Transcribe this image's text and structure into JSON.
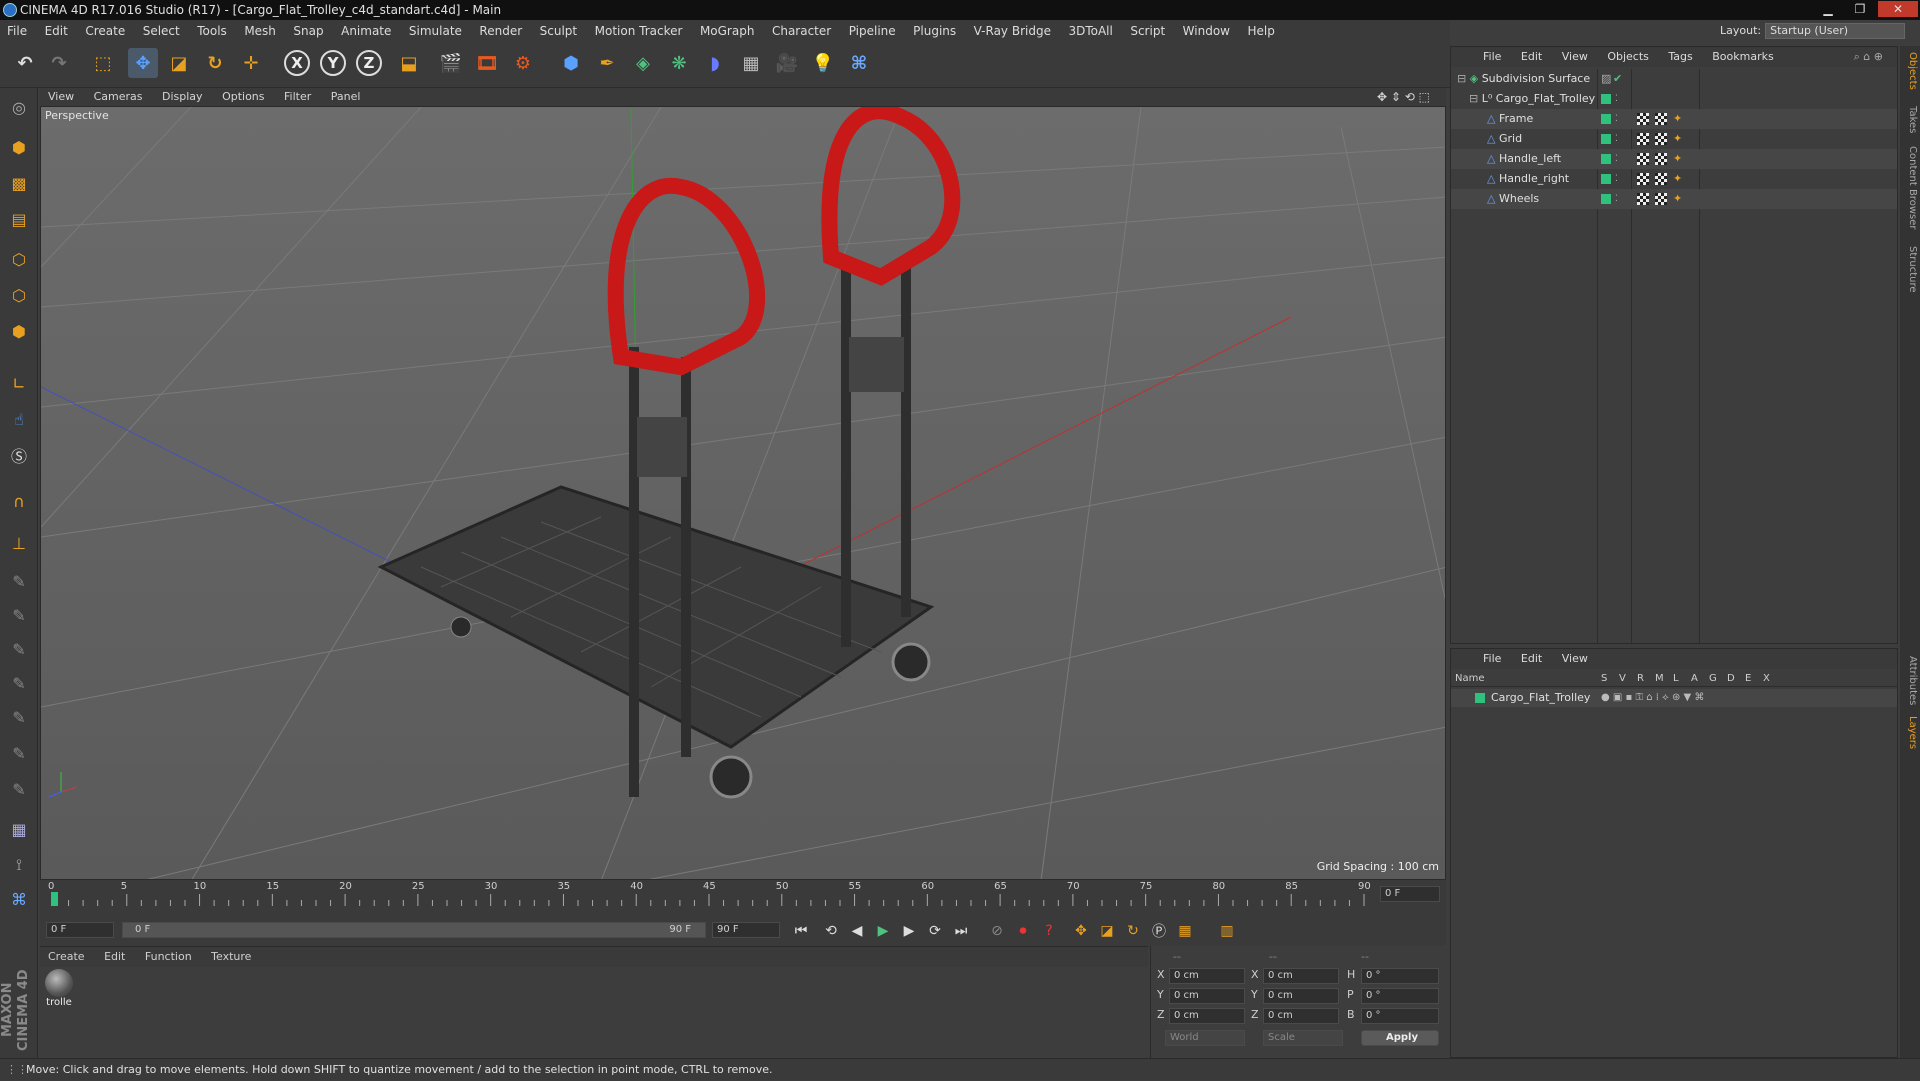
{
  "window": {
    "title": "CINEMA 4D R17.016 Studio (R17) - [Cargo_Flat_Trolley_c4d_standart.c4d] - Main",
    "min": "▁",
    "max": "❐",
    "close": "✕"
  },
  "menubar": [
    "File",
    "Edit",
    "Create",
    "Select",
    "Tools",
    "Mesh",
    "Snap",
    "Animate",
    "Simulate",
    "Render",
    "Sculpt",
    "Motion Tracker",
    "MoGraph",
    "Character",
    "Pipeline",
    "Plugins",
    "V-Ray Bridge",
    "3DToAll",
    "Script",
    "Window",
    "Help"
  ],
  "layout": {
    "label": "Layout:",
    "value": "Startup (User)"
  },
  "toolbar": {
    "x": "X",
    "y": "Y",
    "z": "Z"
  },
  "viewport": {
    "menu": [
      "View",
      "Cameras",
      "Display",
      "Options",
      "Filter",
      "Panel"
    ],
    "label": "Perspective",
    "grid_spacing": "Grid Spacing : 100 cm"
  },
  "timeline": {
    "ticks": [
      "0",
      "5",
      "10",
      "15",
      "20",
      "25",
      "30",
      "35",
      "40",
      "45",
      "50",
      "55",
      "60",
      "65",
      "70",
      "75",
      "80",
      "85",
      "90"
    ],
    "current_frame": "0 F",
    "start": "0 F",
    "range_start": "0 F",
    "range_end": "90 F",
    "end": "90 F"
  },
  "materials": {
    "menu": [
      "Create",
      "Edit",
      "Function",
      "Texture"
    ],
    "items": [
      {
        "name": "trolle"
      }
    ]
  },
  "coordinates": {
    "headers": [
      "--",
      "--",
      "--"
    ],
    "rows": [
      {
        "a": "X",
        "av": "0 cm",
        "b": "X",
        "bv": "0 cm",
        "c": "H",
        "cv": "0 °"
      },
      {
        "a": "Y",
        "av": "0 cm",
        "b": "Y",
        "bv": "0 cm",
        "c": "P",
        "cv": "0 °"
      },
      {
        "a": "Z",
        "av": "0 cm",
        "b": "Z",
        "bv": "0 cm",
        "c": "B",
        "cv": "0 °"
      }
    ],
    "space": "World",
    "mode": "Scale",
    "apply": "Apply"
  },
  "objects": {
    "menu": [
      "File",
      "Edit",
      "View",
      "Objects",
      "Tags",
      "Bookmarks"
    ],
    "tree": [
      {
        "name": "Subdivision Surface",
        "level": 0
      },
      {
        "name": "Cargo_Flat_Trolley",
        "level": 1
      },
      {
        "name": "Frame",
        "level": 2
      },
      {
        "name": "Grid",
        "level": 2
      },
      {
        "name": "Handle_left",
        "level": 2
      },
      {
        "name": "Handle_right",
        "level": 2
      },
      {
        "name": "Wheels",
        "level": 2
      }
    ]
  },
  "layers": {
    "menu": [
      "File",
      "Edit",
      "View"
    ],
    "name_header": "Name",
    "col_headers": [
      "S",
      "V",
      "R",
      "M",
      "L",
      "A",
      "G",
      "D",
      "E",
      "X"
    ],
    "rows": [
      {
        "name": "Cargo_Flat_Trolley"
      }
    ]
  },
  "right_tabs": [
    "Objects",
    "Takes",
    "Content Browser",
    "Structure",
    "Attributes",
    "Layers"
  ],
  "status": "Move: Click and drag to move elements. Hold down SHIFT to quantize movement / add to the selection in point mode, CTRL to remove.",
  "brand": "MAXON CINEMA 4D",
  "colors": {
    "accent": "#e8a020",
    "layer_green": "#2ec27e",
    "trolley_red": "#c81818"
  }
}
